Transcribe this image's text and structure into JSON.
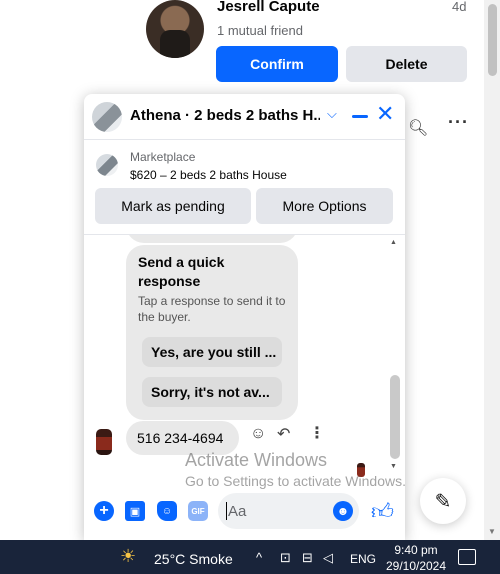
{
  "friend_request": {
    "name": "Jesrell Capute",
    "mutual": "1 mutual friend",
    "time": "4d",
    "confirm_label": "Confirm",
    "delete_label": "Delete"
  },
  "chat": {
    "title": "Athena · 2 beds 2 baths H...",
    "marketplace_label": "Marketplace",
    "listing": "$620 – 2 beds 2 baths House",
    "mark_pending_label": "Mark as pending",
    "more_options_label": "More Options",
    "quick_reply": {
      "title": "Send a quick response",
      "description": "Tap a response to send it to the buyer.",
      "options": [
        "Yes, are you still ...",
        "Sorry, it's not av..."
      ]
    },
    "last_message": "516 234-4694",
    "composer_placeholder": "Aa"
  },
  "watermark": {
    "line1": "Activate Windows",
    "line2": "Go to Settings to activate Windows."
  },
  "taskbar": {
    "weather": "25°C  Smoke",
    "lang": "ENG",
    "time": "9:40 pm",
    "date": "29/10/2024"
  },
  "colors": {
    "accent": "#0866ff",
    "button_gray": "#e4e6eb",
    "taskbar": "#19243a"
  }
}
